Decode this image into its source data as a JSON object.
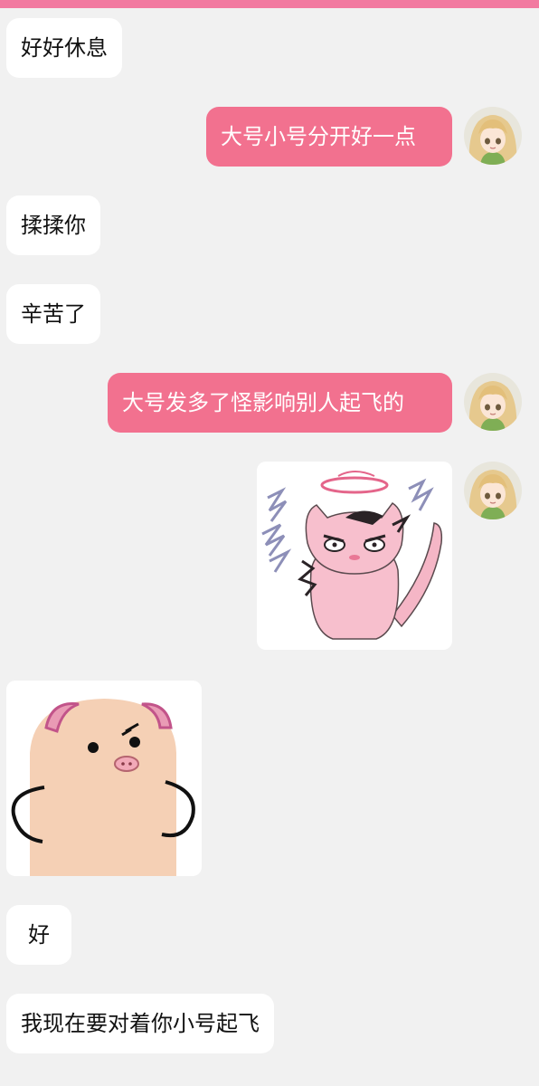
{
  "colors": {
    "accent": "#f27aa0",
    "outgoing_bubble": "#f2718f",
    "incoming_bubble": "#ffffff",
    "background": "#f1f1f1"
  },
  "messages": [
    {
      "side": "in",
      "text": "好好休息"
    },
    {
      "side": "out",
      "text": "大号小号分开好一点"
    },
    {
      "side": "in",
      "text": "揉揉你"
    },
    {
      "side": "in",
      "text": "辛苦了"
    },
    {
      "side": "out",
      "text": "大号发多了怪影响别人起飞的"
    },
    {
      "side": "out",
      "sticker": "angry-pink-cat-sticker"
    },
    {
      "side": "in",
      "sticker": "angry-pig-sticker"
    },
    {
      "side": "in",
      "text": "好"
    },
    {
      "side": "in",
      "text": "我现在要对着你小号起飞"
    }
  ],
  "avatar": {
    "icon": "anime-girl-avatar-icon"
  }
}
